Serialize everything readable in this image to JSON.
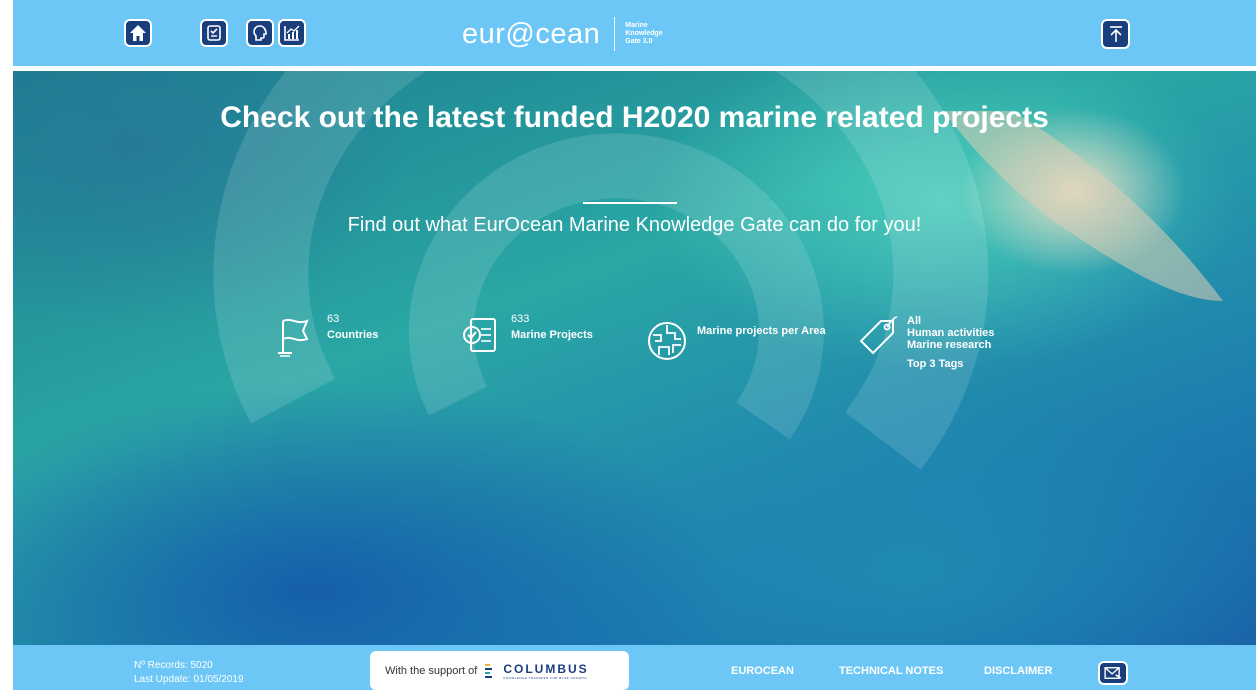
{
  "header": {
    "nav_icons": [
      "home-icon",
      "projects-icon",
      "knowledge-icon",
      "statistics-icon"
    ],
    "logo": {
      "wordmark": "eur@cean",
      "sub_lines": [
        "Marine",
        "Knowledge",
        "Gate 3.0"
      ]
    },
    "back_to_top_icon": "arrow-up-icon"
  },
  "hero": {
    "title": "Check out the latest funded H2020 marine related projects",
    "subtitle": "Find out what EurOcean Marine Knowledge Gate can do for you!",
    "stats": [
      {
        "icon": "flag-icon",
        "value": "63",
        "label": "Countries"
      },
      {
        "icon": "document-check-icon",
        "value": "633",
        "label": "Marine Projects"
      },
      {
        "icon": "map-area-icon",
        "value": "",
        "label": "Marine projects per Area"
      },
      {
        "icon": "tag-icon",
        "tags": [
          "All",
          "Human activities",
          "Marine research"
        ],
        "label": "Top 3 Tags"
      }
    ]
  },
  "footer": {
    "records": "Nº Records: 5020",
    "last_update": "Last Update: 01/05/2019",
    "support_text": "With the support of",
    "support_logo": "COLUMBUS",
    "support_tagline": "KNOWLEDGE TRANSFER FOR BLUE GROWTH",
    "links": [
      "EUROCEAN",
      "TECHNICAL NOTES",
      "DISCLAIMER"
    ],
    "contact_icon": "mail-icon"
  },
  "colors": {
    "bar": "#6cc7f6",
    "button": "#1a3d7c",
    "text_light": "#ffffff"
  }
}
